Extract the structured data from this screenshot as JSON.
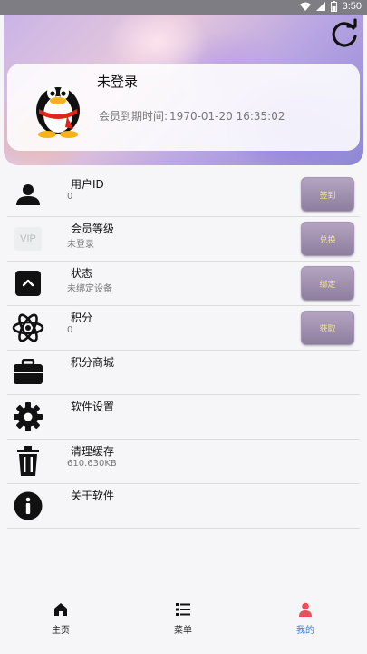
{
  "status_bar": {
    "time": "3:50",
    "icons": [
      "wifi-icon",
      "signal-icon",
      "battery-icon"
    ]
  },
  "header": {
    "refresh_icon": "refresh-icon",
    "login_title": "未登录",
    "vip_expiry_label": "会员到期时间:",
    "vip_expiry_value": "1970-01-20 16:35:02"
  },
  "list": [
    {
      "icon": "user-icon",
      "title": "用户ID",
      "sub": "0",
      "button": "签到"
    },
    {
      "icon": "vip-icon",
      "title": "会员等级",
      "sub": "未登录",
      "button": "兑换",
      "vip_text": "VIP"
    },
    {
      "icon": "status-icon",
      "title": "状态",
      "sub": "未绑定设备",
      "button": "绑定"
    },
    {
      "icon": "atom-icon",
      "title": "积分",
      "sub": "0",
      "button": "获取"
    },
    {
      "icon": "briefcase-icon",
      "title": "积分商城"
    },
    {
      "icon": "gear-icon",
      "title": "软件设置"
    },
    {
      "icon": "trash-icon",
      "title": "清理缓存",
      "sub": "610.630KB"
    },
    {
      "icon": "info-icon",
      "title": "关于软件"
    }
  ],
  "nav": [
    {
      "icon": "home-icon",
      "label": "主页"
    },
    {
      "icon": "menu-list-icon",
      "label": "菜单"
    },
    {
      "icon": "person-icon",
      "label": "我的",
      "active": true
    }
  ],
  "colors": {
    "accent": "#3a7fd8",
    "button_text": "#f0e58a",
    "button_bg": "#9f90ae"
  }
}
